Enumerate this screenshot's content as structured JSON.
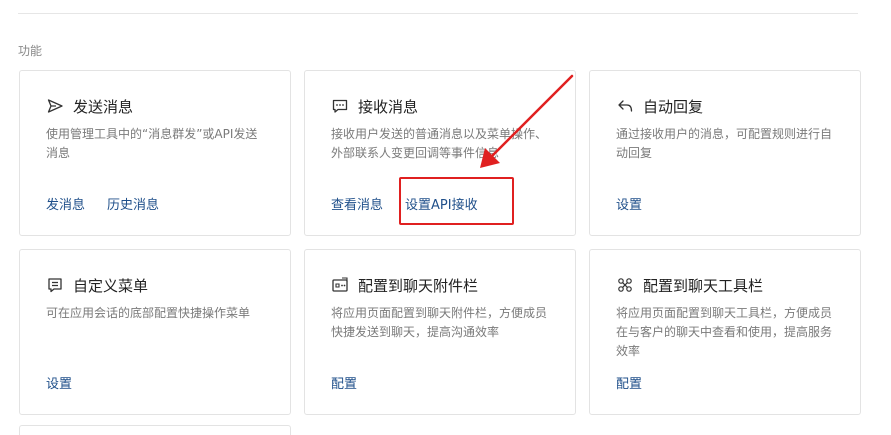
{
  "section": {
    "label": "功能"
  },
  "cards": [
    {
      "icon": "send-icon",
      "title": "发送消息",
      "desc": "使用管理工具中的“消息群发”或API发送消息",
      "actions": [
        "发消息",
        "历史消息"
      ]
    },
    {
      "icon": "message-icon",
      "title": "接收消息",
      "desc": "接收用户发送的普通消息以及菜单操作、外部联系人变更回调等事件信息",
      "actions": [
        "查看消息",
        "设置API接收"
      ]
    },
    {
      "icon": "reply-icon",
      "title": "自动回复",
      "desc": "通过接收用户的消息，可配置规则进行自动回复",
      "actions": [
        "设置"
      ]
    },
    {
      "icon": "menu-icon",
      "title": "自定义菜单",
      "desc": "可在应用会话的底部配置快捷操作菜单",
      "actions": [
        "设置"
      ]
    },
    {
      "icon": "attachment-bar-icon",
      "title": "配置到聊天附件栏",
      "desc": "将应用页面配置到聊天附件栏，方便成员快捷发送到聊天，提高沟通效率",
      "actions": [
        "配置"
      ]
    },
    {
      "icon": "toolbar-icon",
      "title": "配置到聊天工具栏",
      "desc": "将应用页面配置到聊天工具栏，方便成员在与客户的聊天中查看和使用，提高服务效率",
      "actions": [
        "配置"
      ]
    }
  ],
  "annotation": {
    "color": "#e02020"
  }
}
